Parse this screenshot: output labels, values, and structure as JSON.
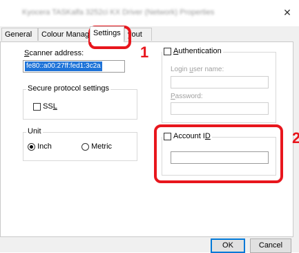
{
  "window": {
    "title": "Kyocera TASKalfa 3252ci KX Driver (Network) Properties",
    "close_glyph": "✕"
  },
  "tabs": [
    {
      "label": "General"
    },
    {
      "label": "Colour Manageme"
    },
    {
      "label": "Settings",
      "active": true
    },
    {
      "label": "yout"
    }
  ],
  "scanner": {
    "label_prefix": "S",
    "label_rest": "canner address:",
    "value": "fe80::a00:27ff:fed1:3c2a"
  },
  "secure": {
    "group_label": "Secure protocol settings",
    "ssl_label_prefix": "SS",
    "ssl_label_underlined": "L",
    "ssl_checked": false
  },
  "unit": {
    "group_label": "Unit",
    "options": [
      {
        "label": "Inch",
        "selected": true
      },
      {
        "label": "Metric",
        "selected": false
      }
    ]
  },
  "authentication": {
    "label_underlined": "A",
    "label_rest": "uthentication",
    "checked": false,
    "login_label_pre": "Login ",
    "login_label_u": "u",
    "login_label_post": "ser name:",
    "password_label_u": "P",
    "password_label_post": "assword:"
  },
  "account": {
    "label_pre": "Account I",
    "label_u": "D",
    "checked": false
  },
  "buttons": {
    "ok": "OK",
    "cancel": "Cancel"
  },
  "annotations": {
    "marker_1": "1",
    "marker_2": "2"
  },
  "colors": {
    "highlight": "#e8161d",
    "selection": "#1e73d8"
  }
}
